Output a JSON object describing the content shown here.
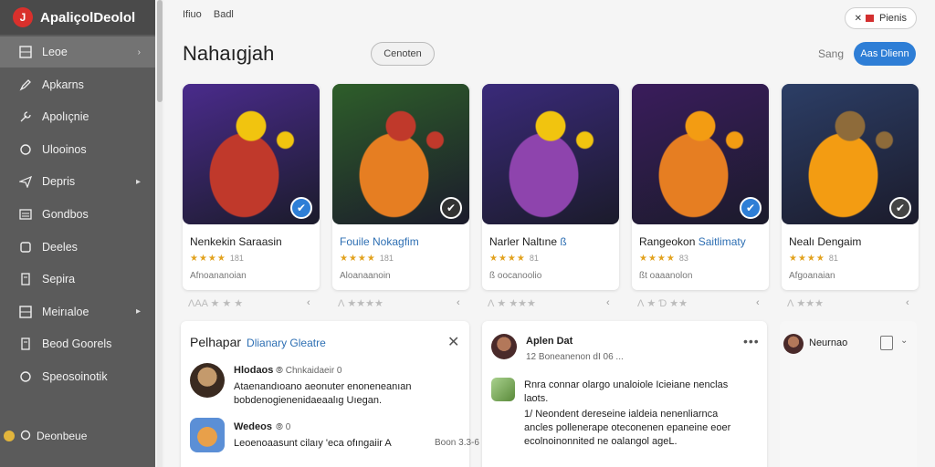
{
  "app": {
    "brand": "ApaliçolDeolol",
    "logo_letter": "J"
  },
  "sidebar": {
    "items": [
      {
        "label": "Leoe",
        "icon": "grid-icon",
        "active": true,
        "arrow": "›"
      },
      {
        "label": "Apkarns",
        "icon": "edit-icon"
      },
      {
        "label": "Apolıçnie",
        "icon": "tools-icon"
      },
      {
        "label": "Ulooinos",
        "icon": "circle-icon"
      },
      {
        "label": "Depris",
        "icon": "send-icon",
        "arrow": "▸"
      },
      {
        "label": "Gondbos",
        "icon": "list-icon"
      },
      {
        "label": "Deeles",
        "icon": "box-icon"
      },
      {
        "label": "Sepira",
        "icon": "doc-icon"
      },
      {
        "label": "Meirıaloe",
        "icon": "grid-icon",
        "arrow": "▸"
      },
      {
        "label": "Beod Goorels",
        "icon": "doc-icon"
      },
      {
        "label": "Speosoinotik",
        "icon": "circle-icon"
      }
    ],
    "footer_label": "Deonbeue"
  },
  "header": {
    "breadcrumb": [
      "Ifiuo",
      "Badl"
    ],
    "pill_label": "Pienis",
    "title": "Nahaıgjah",
    "center_button": "Cenoten",
    "sang_label": "Sang",
    "primary_button": "Aas Dlienn"
  },
  "cards": [
    {
      "title": "Nenkekin Saraasin",
      "accent": "",
      "stars": "★★★★",
      "count": "181",
      "sub": "Afnoananoian",
      "rating": "ɅAA ★ ★ ★",
      "badge_color": "#2e7ed6",
      "badge_icon": "✔",
      "art": [
        "#4a2b8c",
        "#c0392b",
        "#f1c40f"
      ]
    },
    {
      "title": "",
      "accent": "Fouile Nokagfim",
      "stars": "★★★★",
      "count": "181",
      "sub": "Aloanaanoin",
      "rating": "Ʌ ★★★★",
      "badge_color": "#333333",
      "badge_icon": "✔",
      "art": [
        "#2e5e2a",
        "#e67e22",
        "#c0392b"
      ]
    },
    {
      "title": "Narler Naltıne ",
      "accent": "ß",
      "stars": "★★★★",
      "count": "81",
      "sub": "ß oocanoolio",
      "rating": "Ʌ ★ ★★★",
      "badge_color": "",
      "badge_icon": "",
      "art": [
        "#3a2a7a",
        "#8e44ad",
        "#f1c40f"
      ]
    },
    {
      "title": "Rangeokon ",
      "accent": "Saitlimaty",
      "stars": "★★★★",
      "count": "83",
      "sub": "ßt oaaanolon",
      "rating": "Ʌ ★ Ɗ ★★",
      "badge_color": "#2e7ed6",
      "badge_icon": "✔",
      "art": [
        "#3a1c5c",
        "#e67e22",
        "#f39c12"
      ]
    },
    {
      "title": "Nealı Dengaim",
      "accent": "",
      "stars": "★★★★",
      "count": "81",
      "sub": "Afgoanaian",
      "rating": "Ʌ ★★★",
      "badge_color": "#444444",
      "badge_icon": "✔",
      "art": [
        "#2c3e66",
        "#f39c12",
        "#8e6b3a"
      ]
    }
  ],
  "rate_dot": "‹",
  "panel_left": {
    "title": "Pelhapar",
    "title_accent": "Dlianary Gleatre",
    "close": "✕",
    "entries": [
      {
        "name": "Hlodaos",
        "meta": "⦾ Chnkaidaeir 0",
        "line1": "Ataenandıoano aeonuter enoneneanıan",
        "line2": "bobdenogienenidaeaalıg Uıegan."
      },
      {
        "name": "Wedeos",
        "meta": "⦾ 0",
        "line1": "Leoenoaasunt cilaıy 'eca ofıngaiir A",
        "line2": "Boon 3.3-6"
      }
    ]
  },
  "panel_mid": {
    "author": "Aplen Dat",
    "author_meta": "12 Boneanenon dI 06 ...",
    "more": "•••",
    "post_accent": "Rnra connar olargo",
    "post_rest": "unaloiole Icieiane nenclas",
    "post_line2": "laots.",
    "body1": "1/ Neondent dereseine ialdeia nenenliarnca",
    "body2": "ancles pollenerape oteconenen epaneine eoer",
    "body3": "ecolnoinonnited ne oalangol ageL."
  },
  "panel_right": {
    "label": "Neurnao",
    "more": "⌄"
  },
  "colors": {
    "sidebar": "#5b5b5b",
    "accent_blue": "#2e7ed6",
    "star": "#e2a21e"
  }
}
